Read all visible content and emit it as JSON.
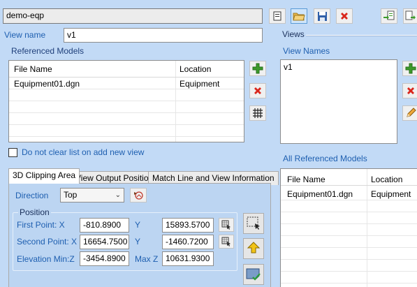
{
  "top": {
    "file_name": "demo-eqp"
  },
  "view_name": {
    "label": "View name",
    "value": "v1"
  },
  "referenced_models": {
    "title": "Referenced Models",
    "columns": [
      "File Name",
      "Location"
    ],
    "rows": [
      {
        "file": "Equipment01.dgn",
        "location": "Equipment"
      }
    ]
  },
  "do_not_clear_label": "Do not clear list on add new view",
  "tabs": [
    "3D Clipping Area",
    "View Output Position",
    "Match Line and View Information"
  ],
  "clipping": {
    "direction_label": "Direction",
    "direction_value": "Top",
    "position_title": "Position",
    "first_point_label": "First Point: X",
    "first_x": "-810.8900",
    "y_label": "Y",
    "first_y": "15893.5700",
    "second_point_label": "Second Point: X",
    "second_x": "16654.7500",
    "y_label_2": "Y",
    "second_y": "-1460.7200",
    "elevation_label": "Elevation Min:Z",
    "elevation_min": "-3454.8900",
    "max_z_label": "Max Z",
    "elevation_max": "10631.9300"
  },
  "views": {
    "title": "Views",
    "view_names_title": "View Names",
    "items": [
      "v1"
    ]
  },
  "all_referenced": {
    "title": "All Referenced Models",
    "columns": [
      "File Name",
      "Location"
    ],
    "rows": [
      {
        "file": "Equipment01.dgn",
        "location": "Equipment"
      }
    ]
  },
  "colors": {
    "background": "#c2daf6",
    "label_blue": "#1e5fb0",
    "delete_red": "#d9261c",
    "add_green": "#3c9a2a"
  }
}
